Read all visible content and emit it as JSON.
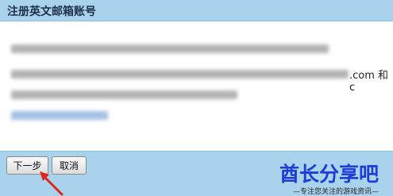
{
  "header": {
    "title": "注册英文邮箱账号"
  },
  "content": {
    "visible_fragments": [
      ".com 和 c"
    ]
  },
  "footer": {
    "next_label": "下一步",
    "cancel_label": "取消"
  },
  "watermark": {
    "logo_text": "酋长分享吧",
    "tagline": "—专注您关注的游戏资讯—"
  },
  "colors": {
    "header_bg": "#a9d2ec",
    "footer_bg": "#a9d2ec",
    "logo": "#1f3bd8",
    "arrow": "#e0261c"
  },
  "icons": [
    "arrow-annotation-icon"
  ]
}
